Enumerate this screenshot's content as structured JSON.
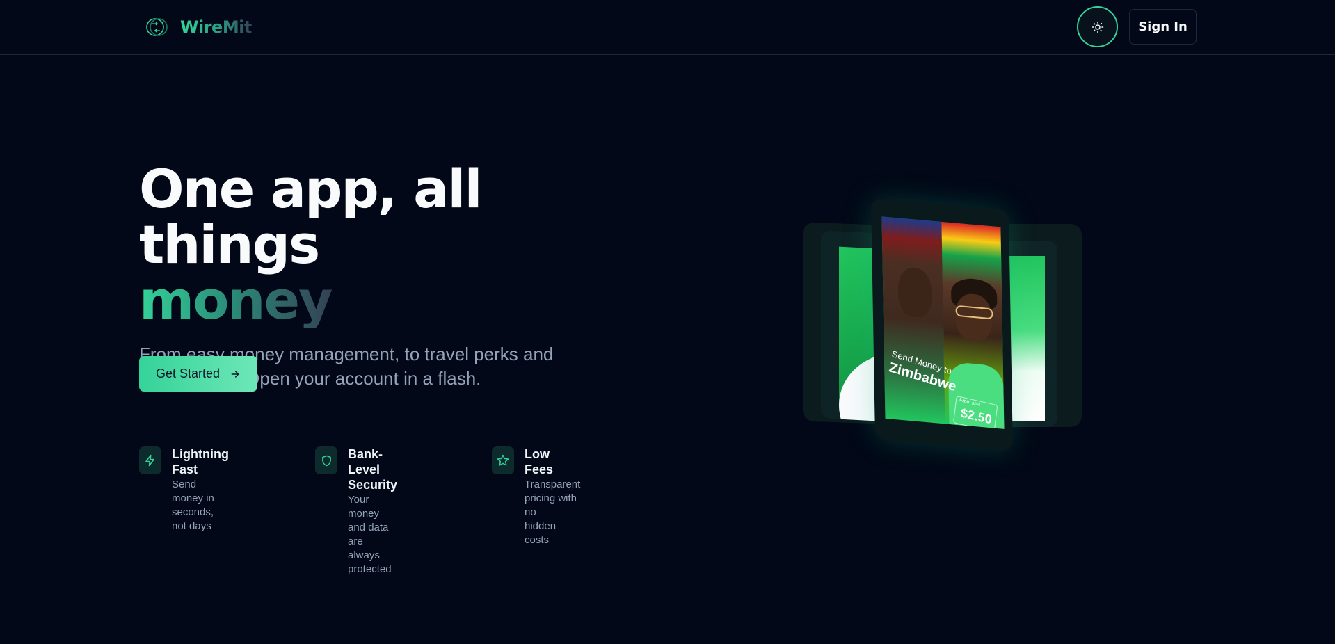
{
  "brand": {
    "name": "WireMit"
  },
  "header": {
    "theme_toggle_icon": "sun-icon",
    "signin_label": "Sign In"
  },
  "hero": {
    "headline_line1": "One app, all things",
    "headline_accent": "money",
    "subtitle": "From easy money management, to travel perks and investments. Open your account in a flash.",
    "cta_label": "Get Started",
    "cta_icon": "arrow-right-icon"
  },
  "features": [
    {
      "icon": "lightning-icon",
      "title": "Lightning Fast",
      "desc_line1": "Send money in seconds,",
      "desc_line2": "not days"
    },
    {
      "icon": "shield-icon",
      "title": "Bank-Level Security",
      "desc_line1": "Your money and data are",
      "desc_line2": "always protected"
    },
    {
      "icon": "star-icon",
      "title": "Low Fees",
      "desc_line1": "Transparent pricing with no",
      "desc_line2": "hidden costs"
    }
  ],
  "showcase": {
    "promo_small": "Send Money to",
    "promo_big": "Zimbabwe",
    "price_mini": "From just",
    "price": "$2.50"
  },
  "colors": {
    "background": "#020817",
    "accent": "#34d399",
    "muted_text": "#94a3b8",
    "border": "#1e293b"
  }
}
